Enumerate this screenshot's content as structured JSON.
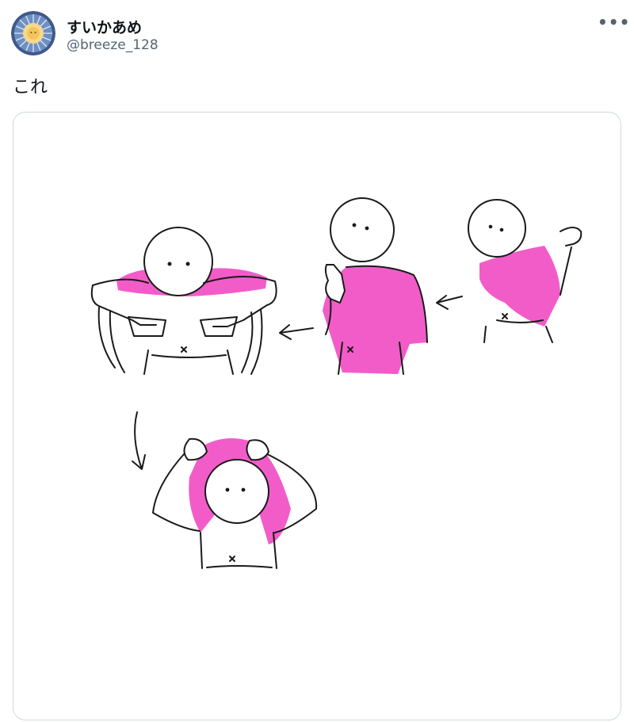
{
  "author": {
    "display_name": "すいかあめ",
    "handle": "@breeze_128",
    "avatar_icon": "sun-dial-avatar"
  },
  "more_menu": {
    "icon": "more-dots-icon",
    "label": "•••"
  },
  "tweet": {
    "text": "これ"
  },
  "media": {
    "type": "illustration",
    "accent_color": "#f03fbf",
    "line_color": "#1a1a1a"
  }
}
